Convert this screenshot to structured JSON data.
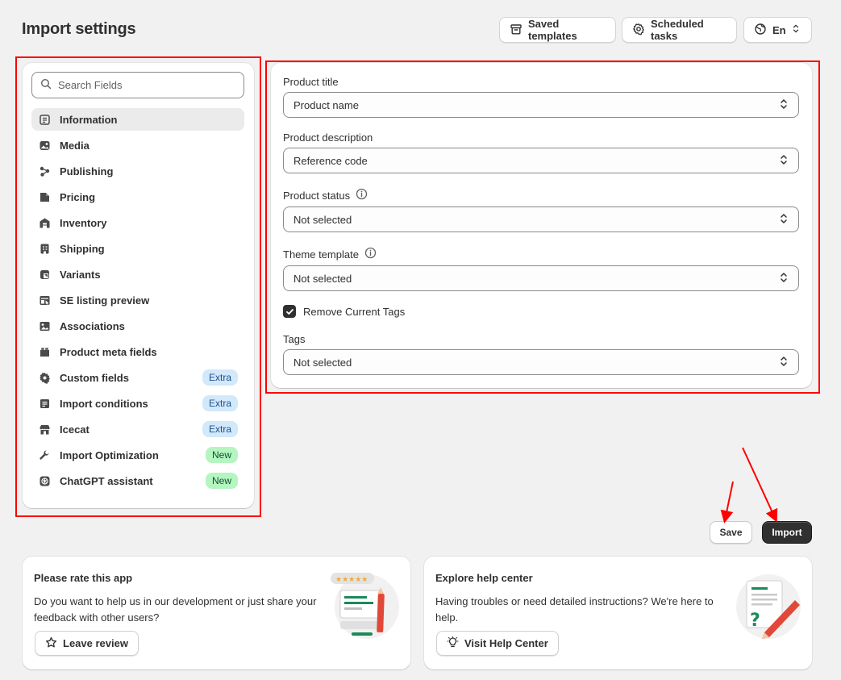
{
  "page": {
    "title": "Import settings"
  },
  "top_actions": {
    "saved_templates": "Saved templates",
    "scheduled_tasks": "Scheduled tasks",
    "language": "En"
  },
  "sidebar": {
    "search_placeholder": "Search Fields",
    "items": [
      {
        "label": "Information",
        "icon": "info-list-icon",
        "active": true
      },
      {
        "label": "Media",
        "icon": "image-icon"
      },
      {
        "label": "Publishing",
        "icon": "publishing-icon"
      },
      {
        "label": "Pricing",
        "icon": "price-tag-icon"
      },
      {
        "label": "Inventory",
        "icon": "inventory-icon"
      },
      {
        "label": "Shipping",
        "icon": "shipping-icon"
      },
      {
        "label": "Variants",
        "icon": "variants-icon"
      },
      {
        "label": "SE listing preview",
        "icon": "search-preview-icon"
      },
      {
        "label": "Associations",
        "icon": "associations-icon"
      },
      {
        "label": "Product meta fields",
        "icon": "metafields-icon"
      },
      {
        "label": "Custom fields",
        "icon": "gear-icon",
        "badge": "Extra"
      },
      {
        "label": "Import conditions",
        "icon": "conditions-icon",
        "badge": "Extra"
      },
      {
        "label": "Icecat",
        "icon": "store-icon",
        "badge": "Extra"
      },
      {
        "label": "Import Optimization",
        "icon": "wrench-icon",
        "badge": "New"
      },
      {
        "label": "ChatGPT assistant",
        "icon": "chatgpt-icon",
        "badge": "New"
      }
    ]
  },
  "form": {
    "product_title": {
      "label": "Product title",
      "value": "Product name"
    },
    "product_description": {
      "label": "Product description",
      "value": "Reference code"
    },
    "product_status": {
      "label": "Product status",
      "value": "Not selected"
    },
    "theme_template": {
      "label": "Theme template",
      "value": "Not selected"
    },
    "remove_current_tags": {
      "label": "Remove Current Tags",
      "checked": true
    },
    "tags": {
      "label": "Tags",
      "value": "Not selected"
    }
  },
  "actions": {
    "save": "Save",
    "import": "Import"
  },
  "promos": {
    "rate": {
      "title": "Please rate this app",
      "text": "Do you want to help us in our development or just share your feedback with other users?",
      "button": "Leave review"
    },
    "help": {
      "title": "Explore help center",
      "text": "Having troubles or need detailed instructions? We're here to help.",
      "button": "Visit Help Center"
    }
  },
  "colors": {
    "annotation": "#ff0000",
    "primary_button": "#303030",
    "badge_extra": "#d2e8fb",
    "badge_new": "#b4f5c0"
  }
}
